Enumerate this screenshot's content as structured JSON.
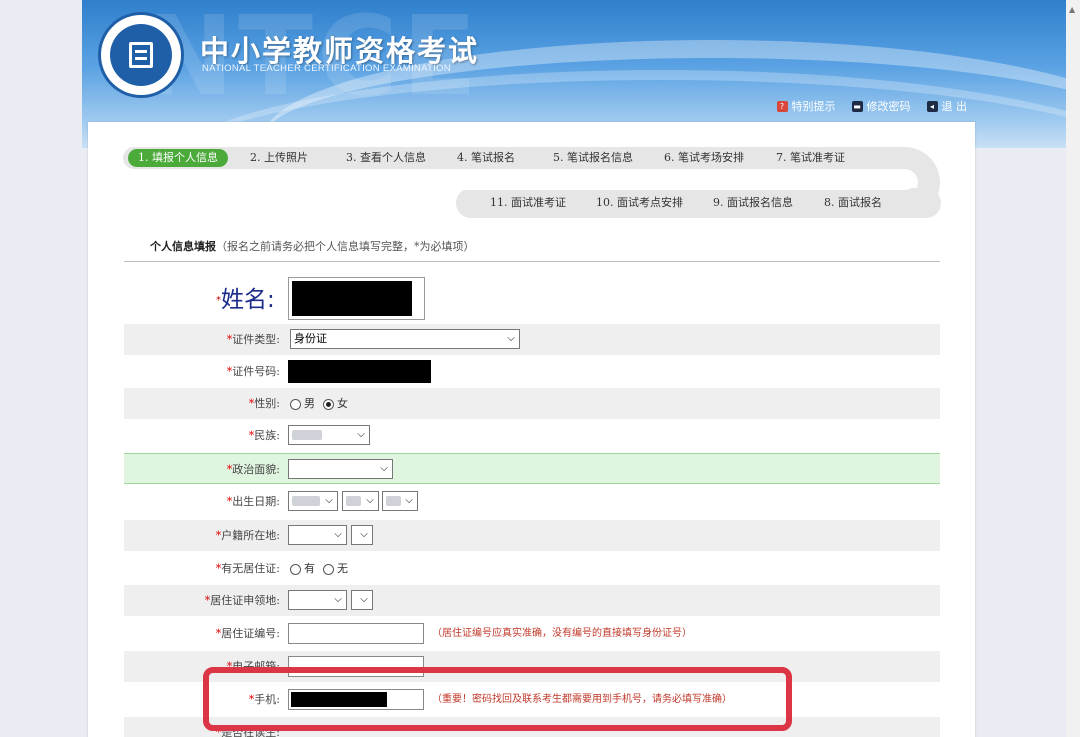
{
  "header": {
    "bg_letters": "NTCE",
    "title": "中小学教师资格考试",
    "subtitle": "NATIONAL TEACHER CERTIFICATION EXAMINATION",
    "links": [
      {
        "icon": "question-icon",
        "label": "特别提示"
      },
      {
        "icon": "key-icon",
        "label": "修改密码"
      },
      {
        "icon": "exit-icon",
        "label": "退  出"
      }
    ]
  },
  "steps_top": [
    {
      "label": "1. 填报个人信息",
      "active": true
    },
    {
      "label": "2. 上传照片"
    },
    {
      "label": "3. 查看个人信息"
    },
    {
      "label": "4. 笔试报名"
    },
    {
      "label": "5. 笔试报名信息"
    },
    {
      "label": "6. 笔试考场安排"
    },
    {
      "label": "7. 笔试准考证"
    }
  ],
  "steps_bottom": [
    {
      "label": "11. 面试准考证"
    },
    {
      "label": "10. 面试考点安排"
    },
    {
      "label": "9. 面试报名信息"
    },
    {
      "label": "8. 面试报名"
    }
  ],
  "section": {
    "title": "个人信息填报",
    "note": "（报名之前请务必把个人信息填写完整，*为必填项）"
  },
  "form": {
    "name_label": "姓名:",
    "req_mark": "*",
    "id_type_label": "证件类型:",
    "id_type_value": "身份证",
    "id_number_label": "证件号码:",
    "gender_label": "性别:",
    "gender_options": [
      "男",
      "女"
    ],
    "ethnicity_label": "民族:",
    "politics_label": "政治面貌:",
    "birth_label": "出生日期:",
    "hukou_label": "户籍所在地:",
    "residence_permit_label": "有无居住证:",
    "residence_options": [
      "有",
      "无"
    ],
    "permit_place_label": "居住证申领地:",
    "permit_number_label": "居住证编号:",
    "permit_number_hint": "（居住证编号应真实准确，没有编号的直接填写身份证号）",
    "email_label": "电子邮箱:",
    "phone_label": "手机:",
    "phone_hint": "（重要！密码找回及联系考生都需要用到手机号，请务必填写准确）",
    "last_label": "是否在读生:"
  }
}
